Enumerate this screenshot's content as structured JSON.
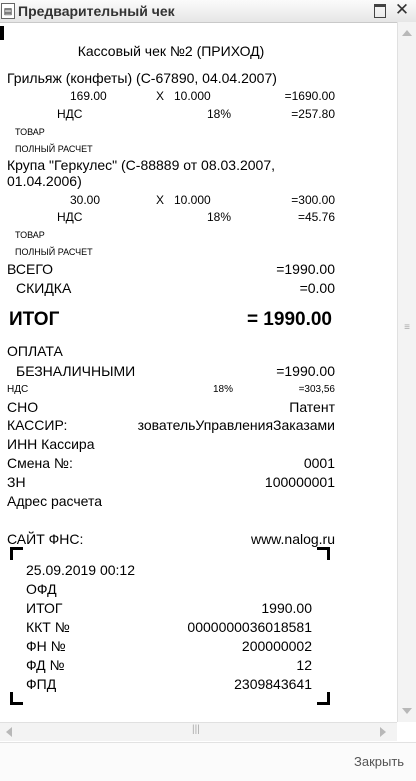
{
  "window": {
    "icon": "document-icon",
    "title": "Предварительный чек"
  },
  "receipt": {
    "header": "Кассовый чек №2 (ПРИХОД)",
    "items": [
      {
        "name": "Грильяж (конфеты) (С-67890, 04.04.2007)",
        "price": "169.00",
        "x": "X",
        "qty": "10.000",
        "sum": "=1690.00",
        "vat_label": "НДС",
        "vat_rate": "18%",
        "vat_sum": "=257.80",
        "subject": "ТОВАР",
        "method": "ПОЛНЫЙ РАСЧЕТ"
      },
      {
        "name_line1": "Крупа   \"Геркулес\"   (С-88889   от   08.03.2007,",
        "name_line2": "01.04.2006)",
        "price": "30.00",
        "x": "X",
        "qty": "10.000",
        "sum": "=300.00",
        "vat_label": "НДС",
        "vat_rate": "18%",
        "vat_sum": "=45.76",
        "subject": "ТОВАР",
        "method": "ПОЛНЫЙ РАСЧЕТ"
      }
    ],
    "total_label": "ВСЕГО",
    "total_value": "=1990.00",
    "discount_label": "СКИДКА",
    "discount_value": "=0.00",
    "itog_label": "ИТОГ",
    "itog_value": "= 1990.00",
    "payment_label": "ОПЛАТА",
    "cashless_label": "БЕЗНАЛИЧНЫМИ",
    "cashless_value": "=1990.00",
    "vat_small_label": "НДС",
    "vat_small_rate": "18%",
    "vat_small_value": "=303,56",
    "sno_label": "СНО",
    "sno_value": "Патент",
    "cashier_label": "КАССИР:",
    "cashier_value": "зовательУправленияЗаказами",
    "inn_label": "ИНН Кассира",
    "shift_label": "Смена №:",
    "shift_value": "0001",
    "zn_label": "ЗН",
    "zn_value": "100000001",
    "address_label": "Адрес расчета",
    "site_label": "САЙТ ФНС:",
    "site_value": "www.nalog.ru",
    "qr": {
      "datetime": "25.09.2019   00:12",
      "ofd": "ОФД",
      "itog_label": "ИТОГ",
      "itog_value": "1990.00",
      "kkt_label": "ККТ №",
      "kkt_value": "0000000036018581",
      "fn_label": "ФН №",
      "fn_value": "200000002",
      "fd_label": "ФД №",
      "fd_value": "12",
      "fpd_label": "ФПД",
      "fpd_value": "2309843641"
    }
  },
  "footer": {
    "close_label": "Закрыть"
  }
}
